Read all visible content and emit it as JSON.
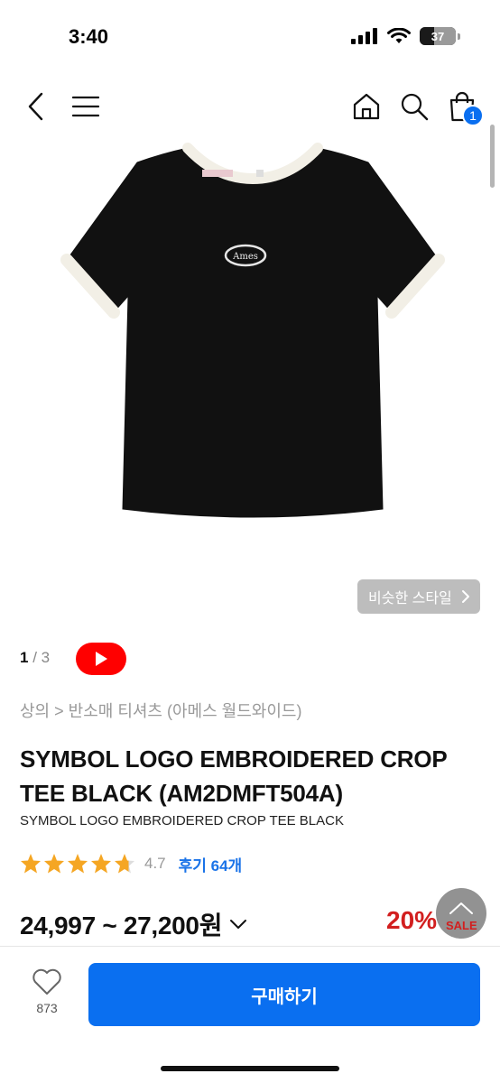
{
  "status_bar": {
    "time": "3:40",
    "battery": "37"
  },
  "nav": {
    "cart_count": "1"
  },
  "gallery": {
    "similar_style_label": "비슷한 스타일",
    "current": "1",
    "separator": "/",
    "total": "3",
    "logo_text": "Ames"
  },
  "breadcrumb": "상의 > 반소매 티셔츠 (아메스 월드와이드)",
  "product": {
    "title": "SYMBOL LOGO EMBROIDERED CROP TEE BLACK (AM2DMFT504A)",
    "subtitle": "SYMBOL LOGO EMBROIDERED CROP TEE BLACK",
    "rating": "4.7",
    "rating_fraction": 0.94,
    "review_label": "후기 64개",
    "price": "24,997 ~ 27,200원",
    "discount": "20%",
    "sale_label": "SALE"
  },
  "bottom_bar": {
    "like_count": "873",
    "buy_label": "구매하기"
  },
  "colors": {
    "accent": "#0a6ff0",
    "discount": "#d21f1f",
    "star": "#f5a623",
    "youtube": "#ff0000"
  }
}
